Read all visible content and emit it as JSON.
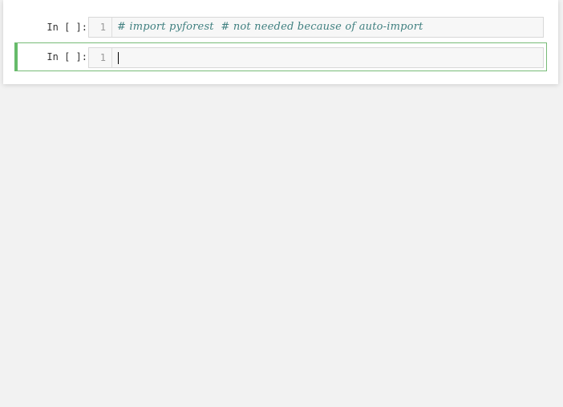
{
  "notebook": {
    "cells": [
      {
        "prompt": "In [ ]:",
        "line_number": "1",
        "code": "# import pyforest  # not needed because of auto-import"
      },
      {
        "prompt": "In [ ]:",
        "line_number": "1",
        "code": ""
      }
    ]
  },
  "colors": {
    "background": "#f2f2f2",
    "selected_cell_border": "#66bb6a",
    "comment": "#408080",
    "prompt": "#333333"
  }
}
